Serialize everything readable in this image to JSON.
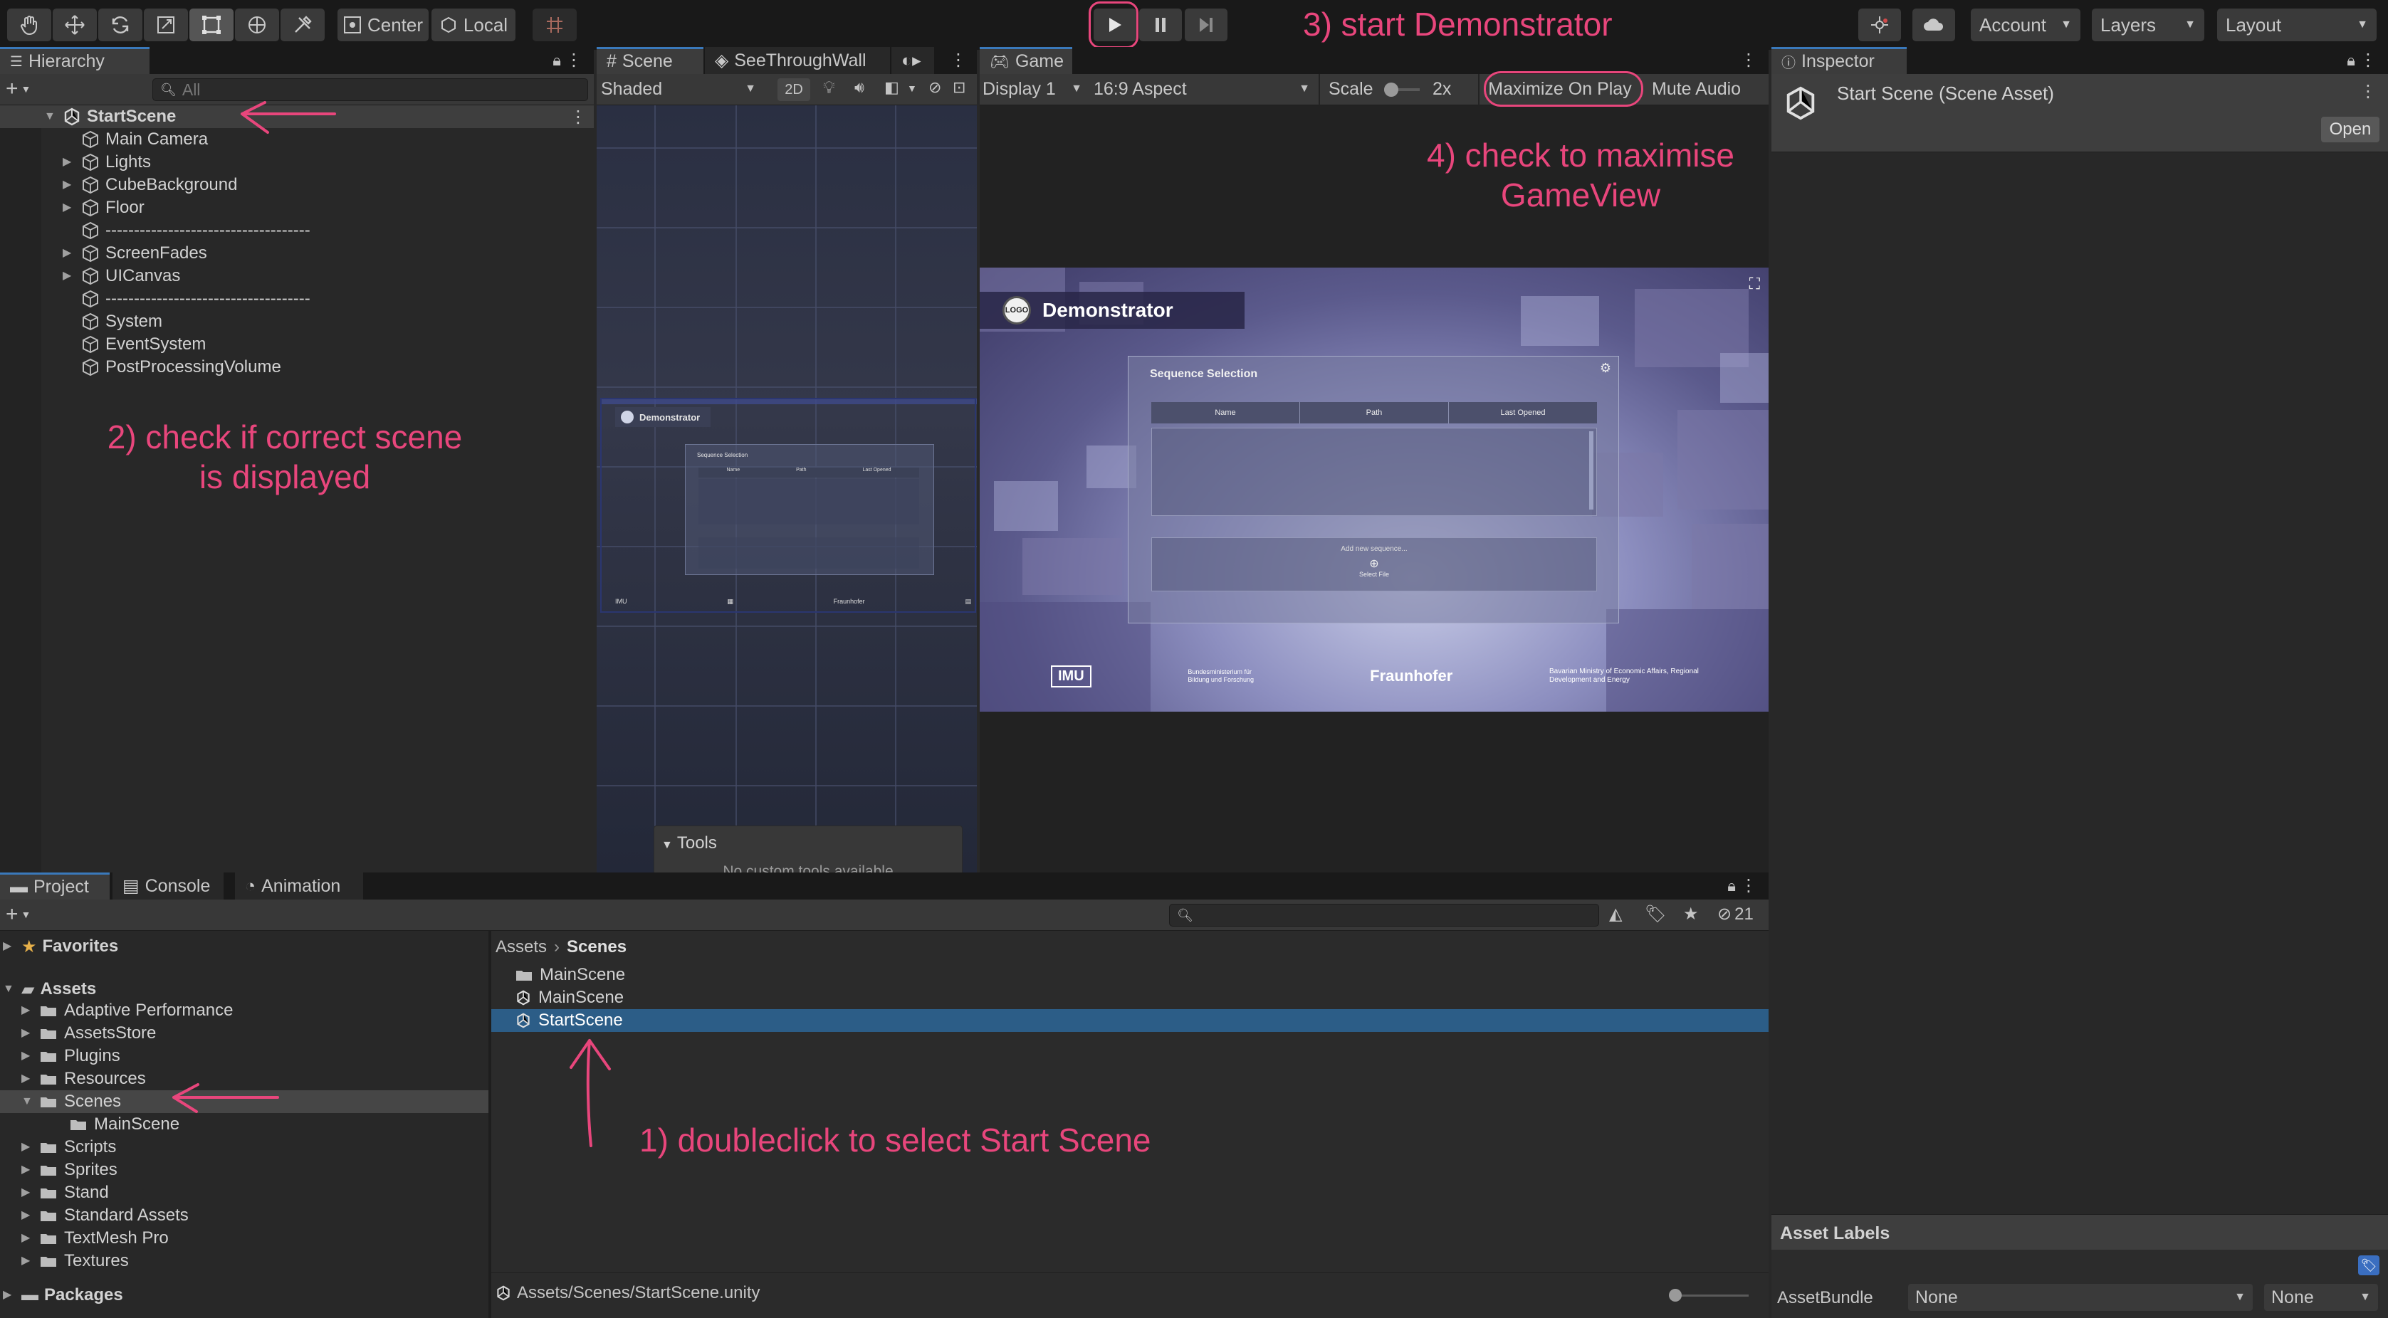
{
  "toolbar": {
    "center_label": "Center",
    "local_label": "Local",
    "account_label": "Account",
    "layers_label": "Layers",
    "layout_label": "Layout"
  },
  "hierarchy": {
    "tab_label": "Hierarchy",
    "search_placeholder": "All",
    "scene_name": "StartScene",
    "items": [
      {
        "label": "Main Camera",
        "expandable": false
      },
      {
        "label": "Lights",
        "expandable": true
      },
      {
        "label": "CubeBackground",
        "expandable": true
      },
      {
        "label": "Floor",
        "expandable": true
      },
      {
        "label": "------------------------------------",
        "expandable": false
      },
      {
        "label": "ScreenFades",
        "expandable": true
      },
      {
        "label": "UICanvas",
        "expandable": true
      },
      {
        "label": "------------------------------------",
        "expandable": false
      },
      {
        "label": "System",
        "expandable": false
      },
      {
        "label": "EventSystem",
        "expandable": false
      },
      {
        "label": "PostProcessingVolume",
        "expandable": false
      }
    ]
  },
  "scene_view": {
    "tabs": [
      "Scene",
      "SeeThroughWall"
    ],
    "shading_mode": "Shaded",
    "mode_2d": "2D",
    "tools_title": "Tools",
    "tools_message": "No custom tools available",
    "ui_title": "Demonstrator",
    "ui_panel_title": "Sequence Selection",
    "ui_columns": [
      "Name",
      "Path",
      "Last Opened"
    ]
  },
  "game_view": {
    "tab_label": "Game",
    "display": "Display 1",
    "aspect": "16:9 Aspect",
    "scale_label": "Scale",
    "scale_value": "2x",
    "maximize_label": "Maximize On Play",
    "mute_label": "Mute Audio",
    "ui_title": "Demonstrator",
    "logo_text": "LOGO",
    "ui_panel_title": "Sequence Selection",
    "ui_columns": [
      "Name",
      "Path",
      "Last Opened"
    ],
    "ui_hint": "Add new sequence...",
    "ui_hint_sub": "Select File",
    "footer_logo1": "IMU",
    "footer_logo2": "Bundesministerium für Bildung und Forschung",
    "footer_logo3": "Fraunhofer",
    "footer_logo4": "Bavarian Ministry of Economic Affairs, Regional Development and Energy"
  },
  "inspector": {
    "tab_label": "Inspector",
    "asset_title": "Start Scene (Scene Asset)",
    "open_button": "Open",
    "asset_labels_title": "Asset Labels",
    "assetbundle_label": "AssetBundle",
    "assetbundle_value": "None",
    "variant_value": "None"
  },
  "project": {
    "tabs": [
      "Project",
      "Console",
      "Animation"
    ],
    "hidden_count": "21",
    "favorites_label": "Favorites",
    "assets_label": "Assets",
    "tree": [
      {
        "label": "Adaptive Performance",
        "depth": 1,
        "expandable": true
      },
      {
        "label": "AssetsStore",
        "depth": 1,
        "expandable": true
      },
      {
        "label": "Plugins",
        "depth": 1,
        "expandable": true
      },
      {
        "label": "Resources",
        "depth": 1,
        "expandable": true
      },
      {
        "label": "Scenes",
        "depth": 1,
        "expandable": true,
        "open": true,
        "selected": true
      },
      {
        "label": "MainScene",
        "depth": 2,
        "expandable": false
      },
      {
        "label": "Scripts",
        "depth": 1,
        "expandable": true
      },
      {
        "label": "Sprites",
        "depth": 1,
        "expandable": true
      },
      {
        "label": "Stand",
        "depth": 1,
        "expandable": true
      },
      {
        "label": "Standard Assets",
        "depth": 1,
        "expandable": true
      },
      {
        "label": "TextMesh Pro",
        "depth": 1,
        "expandable": true
      },
      {
        "label": "Textures",
        "depth": 1,
        "expandable": true
      }
    ],
    "packages_label": "Packages",
    "breadcrumb_root": "Assets",
    "breadcrumb_current": "Scenes",
    "files": [
      {
        "label": "MainScene",
        "kind": "folder"
      },
      {
        "label": "MainScene",
        "kind": "scene"
      },
      {
        "label": "StartScene",
        "kind": "scene",
        "selected": true
      }
    ],
    "status_path": "Assets/Scenes/StartScene.unity"
  },
  "annotations": {
    "step1": "1) doubleclick to select Start Scene",
    "step2": "2) check if correct scene is displayed",
    "step3": "3) start Demonstrator",
    "step4": "4) check to maximise GameView"
  },
  "colors": {
    "annotation": "#e8467c",
    "selection": "#2c5d87",
    "active_tab_accent": "#3a79bb"
  }
}
